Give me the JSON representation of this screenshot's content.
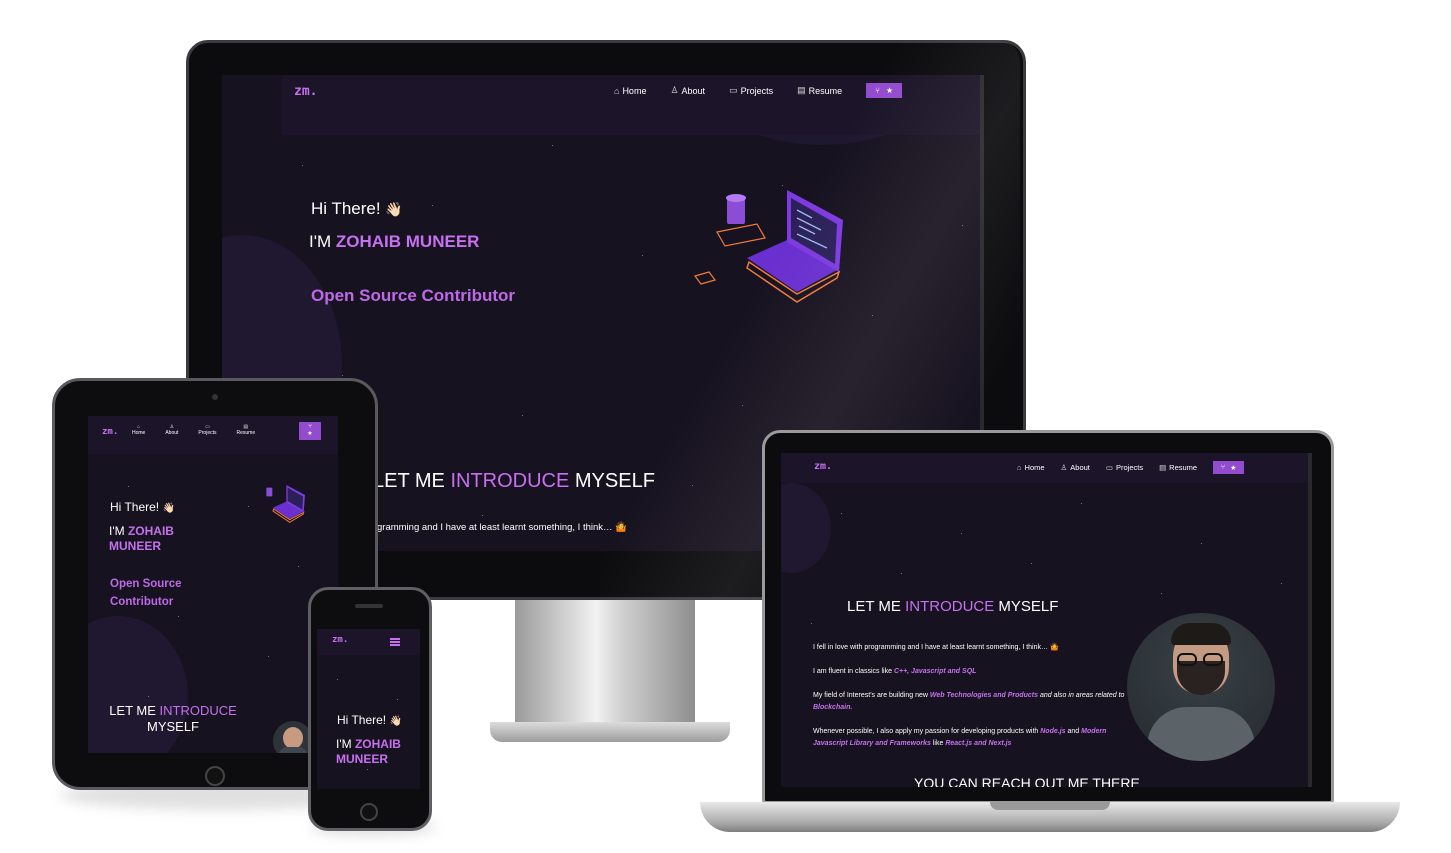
{
  "brand": {
    "logo": "zm."
  },
  "nav": {
    "home": "Home",
    "about": "About",
    "projects": "Projects",
    "resume": "Resume",
    "star": "★"
  },
  "hero": {
    "greeting": "Hi There!",
    "wave": "👋🏻",
    "im": "I'M",
    "name": "ZOHAIB MUNEER",
    "name_line1": "ZOHAIB",
    "name_line2": "MUNEER",
    "typewriter": "Open Source Contributor",
    "typewriter_line1": "Open Source",
    "typewriter_line2": "Contributor"
  },
  "about": {
    "heading_pre": "LET ME",
    "heading_highlight": "INTRODUCE",
    "heading_post": "MYSELF",
    "p1": "I fell in love with programming and I have at least learnt something, I think…",
    "p1_partial": "gramming and I have at least learnt something, I think…",
    "p1_emoji": "🤷",
    "p2_pre": "I am fluent in classics like",
    "p2_langs": "C++, Javascript and SQL",
    "p3_pre": "My field of Interest's are building new",
    "p3_link": "Web Technologies and Products",
    "p3_mid": "and also",
    "p3_mid2": "in areas related to",
    "p3_link2": "Blockchain.",
    "p4_pre": "Whenever possible, I also apply my passion for developing products with",
    "p4_link": "Node.js",
    "p4_and": "and",
    "p4_link2": "Modern Javascript Library and Frameworks",
    "p4_like": "like",
    "p4_link3": "React.js and Next.js"
  },
  "contact": {
    "heading": "YOU CAN REACH OUT ME THERE"
  },
  "icons": {
    "home": "home-icon",
    "about": "user-icon",
    "projects": "projects-icon",
    "resume": "resume-icon",
    "menu": "hamburger-icon",
    "fork": "fork-icon"
  },
  "colors": {
    "accent": "#c770f0",
    "bg": "#17121f",
    "button": "#934cce"
  }
}
